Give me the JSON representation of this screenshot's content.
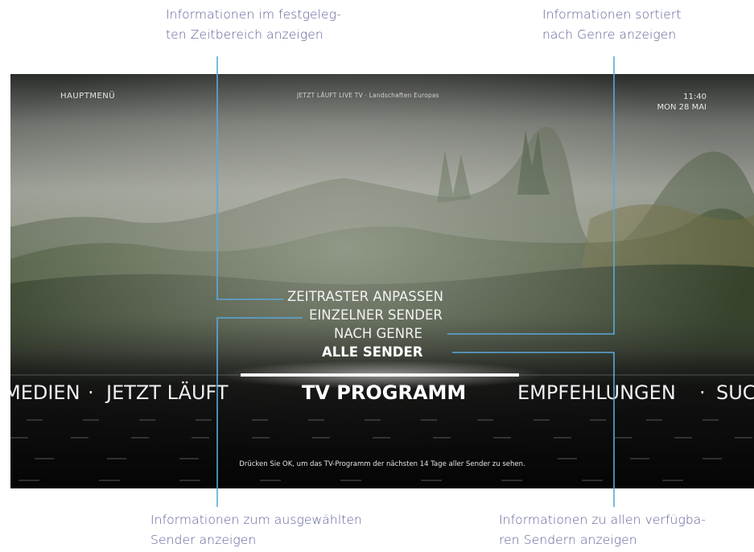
{
  "annotations": {
    "top_left": [
      "Informationen im festgeleg-",
      "ten Zeitbereich anzeigen"
    ],
    "top_right": [
      "Informationen sortiert",
      "nach Genre anzeigen"
    ],
    "bottom_left": [
      "Informationen zum ausgewählten",
      "Sender anzeigen"
    ],
    "bottom_right": [
      "Informationen zu allen verfügba-",
      "ren Sendern anzeigen"
    ]
  },
  "screen": {
    "header": {
      "menu_title": "HAUPTMENÜ",
      "now_playing": "JETZT LÄUFT LIVE TV · Landschaften Europas",
      "time": "11:40",
      "date": "MON 28 MAI"
    },
    "submenu": {
      "items": [
        "ZEITRASTER ANPASSEN",
        "EINZELNER SENDER",
        "NACH GENRE",
        "ALLE SENDER"
      ],
      "selected_index": 3
    },
    "main_menu": {
      "items": [
        "MEDIEN",
        "JETZT LÄUFT",
        "TV PROGRAMM",
        "EMPFEHLUNGEN",
        "SUC"
      ],
      "separator": "·",
      "selected": "TV PROGRAMM"
    },
    "hint": "Drücken Sie OK, um das TV-Programm der nächsten 14 Tage aller Sender zu sehen."
  },
  "colors": {
    "annotation_text": "#5b5f97",
    "leader_line": "#5aa8da",
    "menu_text": "#f0f0f0"
  }
}
